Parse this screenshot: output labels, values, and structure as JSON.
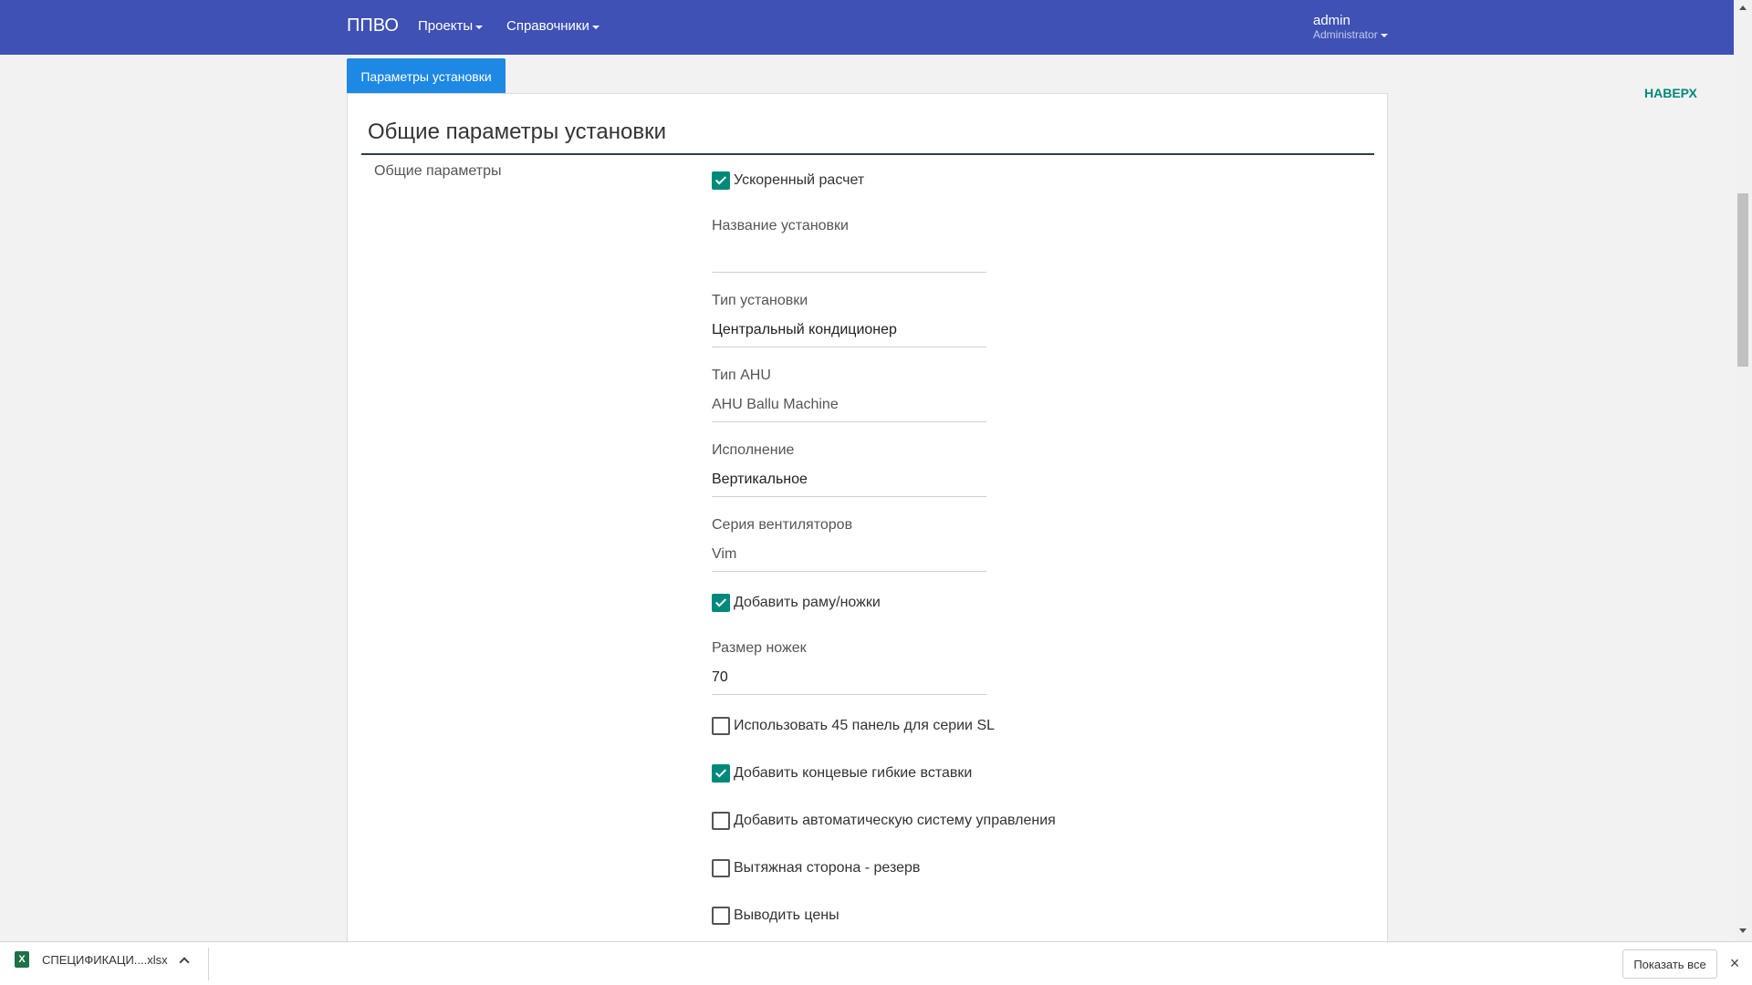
{
  "navbar": {
    "brand": "ППВО",
    "menus": [
      "Проекты",
      "Справочники"
    ],
    "user_name": "admin",
    "user_role": "Administrator"
  },
  "tab": {
    "label": "Параметры установки"
  },
  "to_top": "НАВЕРХ",
  "section": {
    "title": "Общие параметры установки",
    "group_label": "Общие параметры"
  },
  "form": {
    "fast_calc": {
      "label": "Ускоренный расчет",
      "checked": true
    },
    "unit_name": {
      "label": "Название установки",
      "value": ""
    },
    "unit_type": {
      "label": "Тип установки",
      "value": "Центральный кондиционер"
    },
    "ahu_type": {
      "label": "Тип AHU",
      "value": "AHU Ballu Machine"
    },
    "execution": {
      "label": "Исполнение",
      "value": "Вертикальное"
    },
    "fan_series": {
      "label": "Серия вентиляторов",
      "value": "Vim"
    },
    "add_frame": {
      "label": "Добавить раму/ножки",
      "checked": true
    },
    "leg_size": {
      "label": "Размер ножек",
      "value": "70"
    },
    "panel_45": {
      "label": "Использовать 45 панель для серии SL",
      "checked": false
    },
    "flex_inserts": {
      "label": "Добавить концевые гибкие вставки",
      "checked": true
    },
    "auto_control": {
      "label": "Добавить автоматическую систему управления",
      "checked": false
    },
    "exhaust_reserve": {
      "label": "Вытяжная сторона - резерв",
      "checked": false
    },
    "show_prices": {
      "label": "Выводить цены",
      "checked": false
    }
  },
  "download_bar": {
    "file_name": "СПЕЦИФИКАЦИ....xlsx",
    "file_icon": "excel-icon",
    "show_all": "Показать все",
    "close_icon": "×"
  },
  "colors": {
    "navbar": "#3f51b5",
    "tab": "#1e88e5",
    "accent": "#00897b"
  }
}
